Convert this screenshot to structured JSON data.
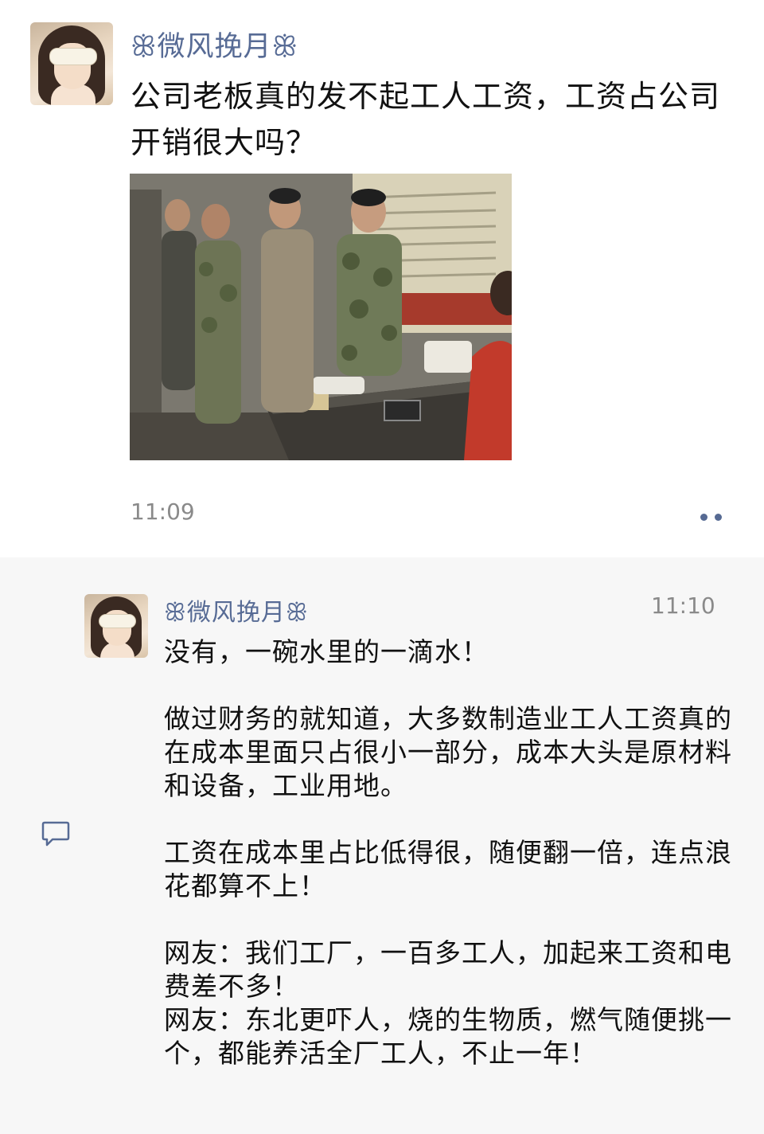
{
  "post": {
    "author": "ꕥ微风挽月ꕥ",
    "text": "公司老板真的发不起工人工资，工资占公司开销很大吗？",
    "time": "11:09",
    "more_icon": "ellipsis-icon",
    "photo_description_icon": "photo"
  },
  "comment": {
    "author": "ꕥ微风挽月ꕥ",
    "time": "11:10",
    "icon": "comment-bubble-icon",
    "paragraphs": [
      "没有，一碗水里的一滴水！",
      "做过财务的就知道，大多数制造业工人工资真的在成本里面只占很小一部分，成本大头是原材料和设备，工业用地。",
      "工资在成本里占比低得很，随便翻一倍，连点浪花都算不上！",
      "网友：我们工厂，一百多工人，加起来工资和电费差不多！",
      "网友：东北更吓人，烧的生物质，燃气随便挑一个，都能养活全厂工人，不止一年！"
    ]
  },
  "colors": {
    "name_link": "#576b95",
    "time": "#8a8a8a",
    "comment_bg": "#f7f7f7"
  }
}
